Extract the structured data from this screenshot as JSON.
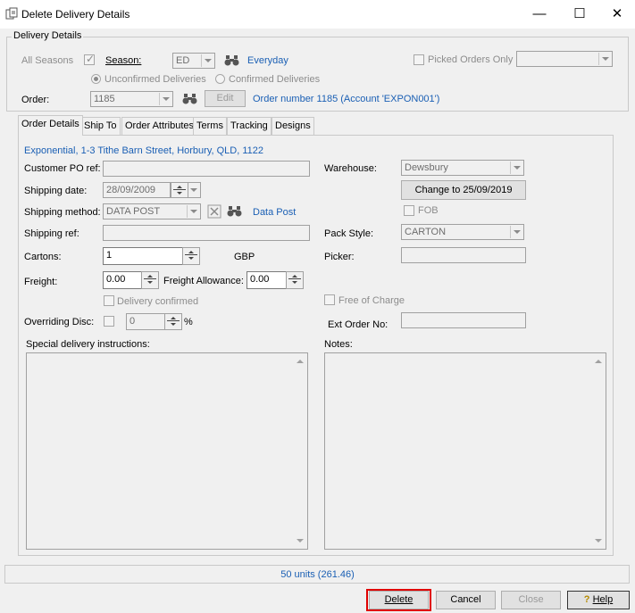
{
  "window": {
    "title": "Delete Delivery Details",
    "minimize_glyph": "—",
    "maximize_glyph": "☐",
    "close_glyph": "✕"
  },
  "delivery_details": {
    "group_label": "Delivery Details",
    "all_seasons_label": "All Seasons",
    "all_seasons_checked": true,
    "season_label": "Season:",
    "season_value": "ED",
    "season_name": "Everyday",
    "picked_orders_only_label": "Picked Orders Only",
    "unconfirmed_label": "Unconfirmed Deliveries",
    "confirmed_label": "Confirmed Deliveries",
    "order_label": "Order:",
    "order_value": "1185",
    "edit_label": "Edit",
    "order_description": "Order number 1185 (Account 'EXPON001')"
  },
  "tabs": [
    {
      "label": "Order Details"
    },
    {
      "label": "Ship To"
    },
    {
      "label": "Order Attributes"
    },
    {
      "label": "Terms"
    },
    {
      "label": "Tracking"
    },
    {
      "label": "Designs"
    }
  ],
  "order_details": {
    "address": "Exponential, 1-3 Tithe Barn Street, Horbury, QLD, 1122",
    "customer_po_label": "Customer PO ref:",
    "customer_po_value": "",
    "shipping_date_label": "Shipping date:",
    "shipping_date_value": "28/09/2009",
    "shipping_method_label": "Shipping method:",
    "shipping_method_value": "DATA POST",
    "shipping_method_name": "Data Post",
    "shipping_ref_label": "Shipping ref:",
    "shipping_ref_value": "",
    "cartons_label": "Cartons:",
    "cartons_value": "1",
    "currency": "GBP",
    "freight_label": "Freight:",
    "freight_value": "0.00",
    "freight_allowance_label": "Freight Allowance:",
    "freight_allowance_value": "0.00",
    "delivery_confirmed_label": "Delivery confirmed",
    "overriding_disc_label": "Overriding Disc:",
    "overriding_disc_value": "0",
    "percent": "%",
    "special_instructions_label": "Special delivery instructions:",
    "warehouse_label": "Warehouse:",
    "warehouse_value": "Dewsbury",
    "change_date_button": "Change to 25/09/2019",
    "fob_label": "FOB",
    "pack_style_label": "Pack Style:",
    "pack_style_value": "CARTON",
    "picker_label": "Picker:",
    "picker_value": "",
    "free_of_charge_label": "Free of Charge",
    "ext_order_label": "Ext Order No:",
    "ext_order_value": "",
    "notes_label": "Notes:"
  },
  "status": {
    "summary": "50 units (261.46)"
  },
  "buttons": {
    "delete": "Delete",
    "cancel": "Cancel",
    "close": "Close",
    "help": "Help"
  },
  "colors": {
    "link": "#1a5fb4",
    "delete_highlight": "#e00000"
  }
}
